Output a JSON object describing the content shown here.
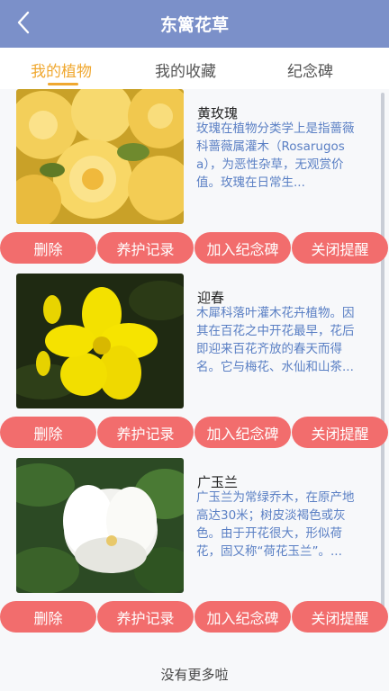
{
  "header": {
    "title": "东篱花草",
    "back_icon": "chevron-left-icon"
  },
  "tabs": [
    {
      "label": "我的植物",
      "active": true
    },
    {
      "label": "我的收藏",
      "active": false
    },
    {
      "label": "纪念碑",
      "active": false
    }
  ],
  "colors": {
    "header_bg": "#7b90c9",
    "tab_active": "#f0a830",
    "button_bg": "#f26d6d",
    "desc_text": "#5a7fc4"
  },
  "plants": [
    {
      "name": "黄玫瑰",
      "description": "玫瑰在植物分类学上是指蔷薇科蔷薇属灌木（Rosarugosa），为恶性杂草，无观赏价值。玫瑰在日常生...",
      "actions": [
        "删除",
        "养护记录",
        "加入纪念碑",
        "关闭提醒"
      ]
    },
    {
      "name": "迎春",
      "description": "木犀科落叶灌木花卉植物。因其在百花之中开花最早，花后即迎来百花齐放的春天而得名。它与梅花、水仙和山茶...",
      "actions": [
        "删除",
        "养护记录",
        "加入纪念碑",
        "关闭提醒"
      ]
    },
    {
      "name": "广玉兰",
      "description": "广玉兰为常绿乔木，在原产地高达30米；树皮淡褐色或灰色。由于开花很大，形似荷花，固又称“荷花玉兰”。...",
      "actions": [
        "删除",
        "养护记录",
        "加入纪念碑",
        "关闭提醒"
      ]
    }
  ],
  "footer": {
    "text": "没有更多啦"
  }
}
